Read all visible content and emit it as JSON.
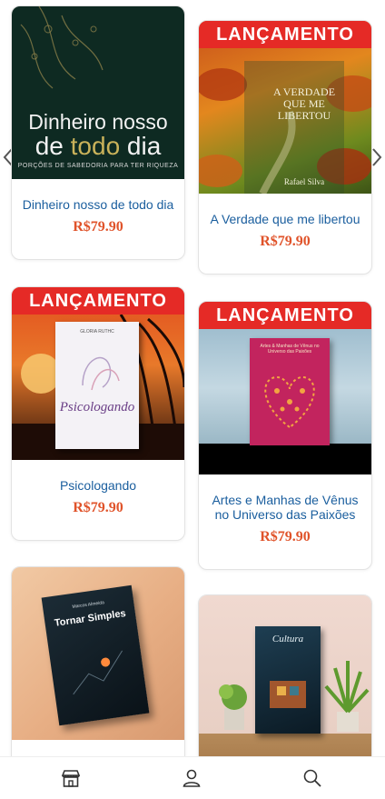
{
  "carousel": {
    "prev_icon": "chevron-left-icon",
    "next_icon": "chevron-right-icon"
  },
  "products": [
    {
      "title": "Dinheiro nosso de todo dia",
      "price": "R$79.90",
      "ribbon": "",
      "cover": {
        "line1": "Dinheiro nosso",
        "line2_a": "de ",
        "line2_b": "todo",
        "line2_c": " dia",
        "subtitle": "PORÇÕES DE SABEDORIA PARA TER RIQUEZA"
      }
    },
    {
      "title": "A Verdade que me libertou",
      "price": "R$79.90",
      "ribbon": "LANÇAMENTO",
      "cover": {
        "heading_a": "A VERDADE",
        "heading_b": "QUE ME LIBERTOU",
        "author": "Rafael Silva"
      }
    },
    {
      "title": "Psicologando",
      "price": "R$79.90",
      "ribbon": "LANÇAMENTO",
      "cover": {
        "heading": "Psicologando",
        "author": "GLORIA RUTHC"
      }
    },
    {
      "title": "Artes e Manhas de Vênus no Universo das Paixões",
      "price": "R$79.90",
      "ribbon": "LANÇAMENTO",
      "cover": {
        "heading": "Artes & Manhas de Vênus no Universo das Paixões"
      }
    },
    {
      "title": "",
      "price": "",
      "ribbon": "",
      "cover": {
        "heading": "Tornar Simples",
        "author": "Marcos Almeida"
      }
    },
    {
      "title": "",
      "price": "",
      "ribbon": "",
      "cover": {
        "heading": "Cultura"
      }
    }
  ],
  "bottom_nav": [
    {
      "icon": "store-icon"
    },
    {
      "icon": "user-icon"
    },
    {
      "icon": "search-icon"
    }
  ],
  "colors": {
    "ribbon": "#e52a26",
    "title": "#1a5e9e",
    "price": "#e0532a"
  }
}
